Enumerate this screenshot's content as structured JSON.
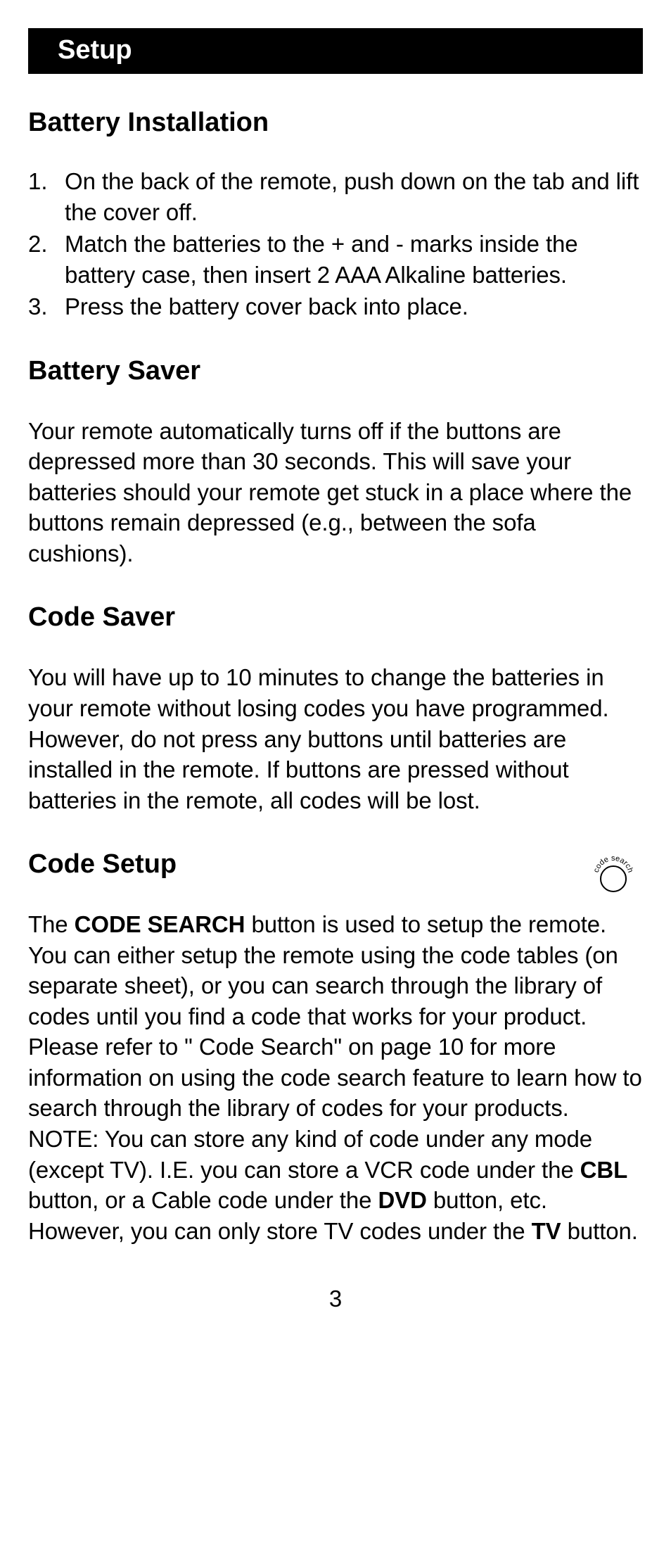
{
  "header": {
    "title": "Setup"
  },
  "sections": {
    "battery_installation": {
      "heading": "Battery Installation",
      "steps": [
        "On the back of the remote, push down on the tab and lift the cover off.",
        "Match the batteries to the + and - marks inside the battery case, then insert 2 AAA Alkaline batteries.",
        "Press the battery cover back into place."
      ]
    },
    "battery_saver": {
      "heading": "Battery Saver",
      "body": "Your remote automatically turns off if the buttons are depressed more than 30 seconds. This will save your batteries should your remote get stuck in a place where the buttons remain depressed (e.g., between the sofa cushions)."
    },
    "code_saver": {
      "heading": "Code Saver",
      "body": "You will have up to 10 minutes to change the batteries in your remote without losing codes you have programmed. However, do not press any buttons until batteries are installed in the remote. If buttons are pressed without batteries in the remote, all codes will be lost."
    },
    "code_setup": {
      "heading": "Code Setup",
      "icon_label": "code search",
      "p1_pre": "The ",
      "p1_bold1": "CODE SEARCH",
      "p1_mid1": " button is used to setup the remote. You can either setup the remote using the code tables (on separate sheet), or you can search through the library of codes until you find a code that works for your product. Please refer to \" Code Search\" on page 10 for more information on using the code search feature to learn how to search through the library of codes for your products.",
      "p2_pre": "NOTE: You can store any kind of code under any mode (except TV). I.E. you can store a VCR code under the ",
      "p2_bold1": "CBL",
      "p2_mid1": " button, or a Cable code under the ",
      "p2_bold2": "DVD",
      "p2_mid2": " button, etc. However, you can only store TV codes under the ",
      "p2_bold3": "TV",
      "p2_end": " button."
    }
  },
  "page_number": "3"
}
